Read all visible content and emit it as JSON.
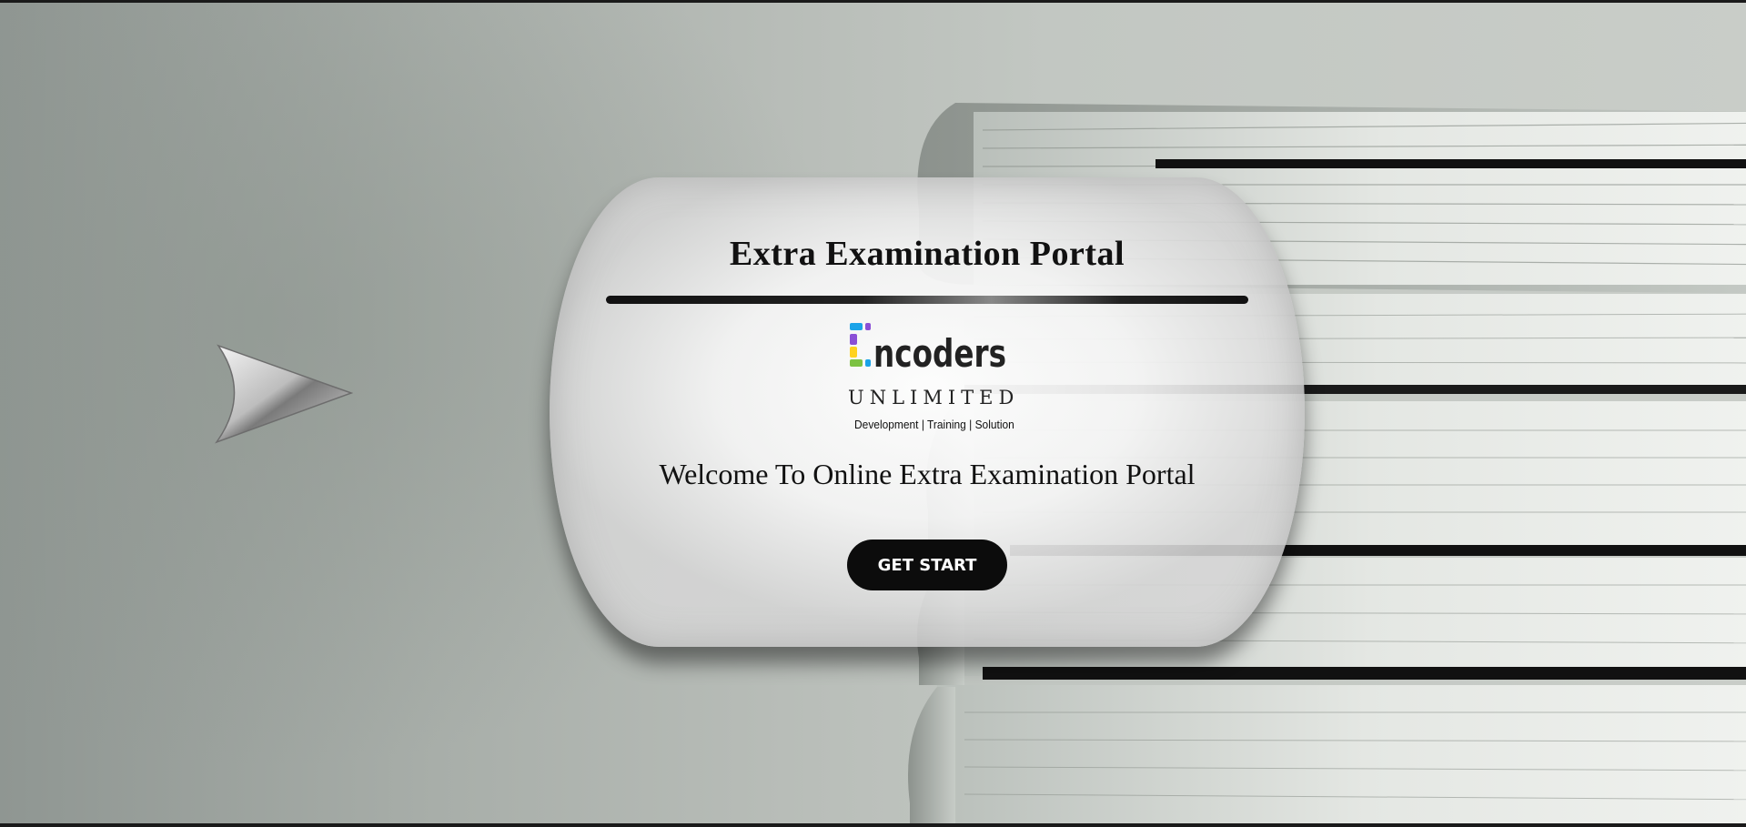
{
  "portal": {
    "title": "Extra Examination Portal",
    "welcome": "Welcome To Online Extra Examination Portal",
    "start_button": "GET START"
  },
  "logo": {
    "name": "Encoders",
    "subtitle": "UNLIMITED",
    "tagline": "Development | Training | Solution",
    "colors": [
      "#1aa3e8",
      "#8a4fd6",
      "#ffd21e",
      "#7cc242",
      "#222222"
    ]
  },
  "icons": {
    "nav": "right-arrow-icon",
    "background": "book-stack-image"
  },
  "colors": {
    "button_bg": "#0c0c0c",
    "button_text": "#ffffff",
    "title_text": "#111111"
  }
}
